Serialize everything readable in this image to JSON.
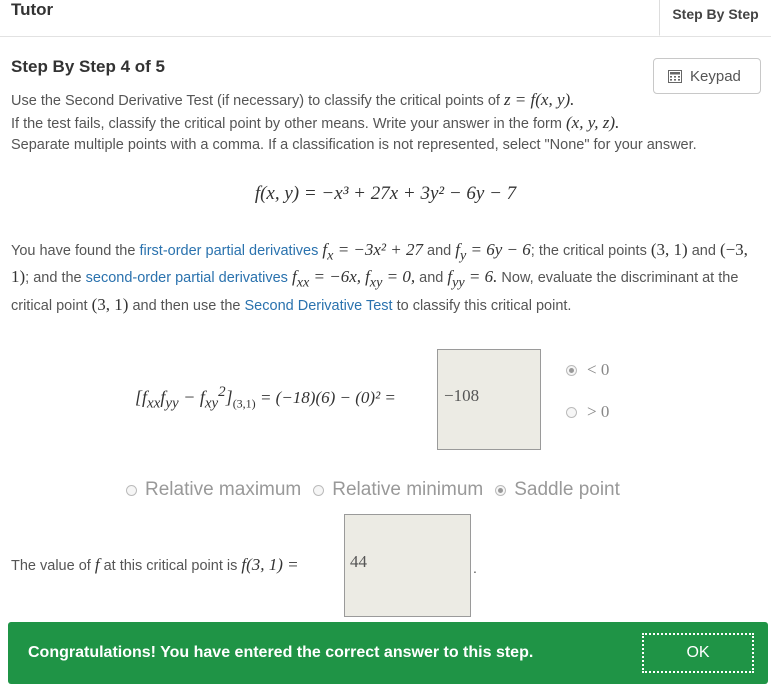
{
  "header": {
    "title": "Tutor",
    "tab": "Step By Step"
  },
  "step": {
    "heading": "Step By Step 4 of 5",
    "keypad_label": "Keypad"
  },
  "intro": {
    "line1_text": "Use the Second Derivative Test (if necessary) to classify the critical points of ",
    "line1_math": "z = f(x, y).",
    "line2_text": "If the test fails, classify the critical point by other means. Write your answer in the form ",
    "line2_math": "(x, y, z).",
    "line3": "Separate multiple points with a comma. If a classification is not represented, select \"None\" for your answer."
  },
  "function_formula": "f(x, y) = −x³ + 27x + 3y² − 6y − 7",
  "found": {
    "t1": "You have found the ",
    "link1": "first-order partial derivatives",
    "fx": "f",
    "fx_sub": "x",
    "fx_rhs": " = −3x² + 27",
    "t2": " and ",
    "fy": "f",
    "fy_sub": "y",
    "fy_rhs": " = 6y − 6",
    "t3": "; the critical points ",
    "cp1": "(3, 1)",
    "t4": " and ",
    "cp2": "(−3, 1)",
    "t5": "; and the ",
    "link2": "second-order partial derivatives",
    "fxx_sub": "xx",
    "fxx_rhs": " = −6x,",
    "fxy_sub": "xy",
    "fxy_rhs": " = 0,",
    "t6": " and ",
    "fyy_sub": "yy",
    "fyy_rhs": " = 6.",
    "t7": " Now, evaluate the discriminant at the critical point ",
    "cp3": "(3, 1)",
    "t8": " and then use the ",
    "link3": "Second Derivative Test",
    "t9": " to classify this critical point."
  },
  "discriminant": {
    "expression_left": "[f",
    "sub_xx": "xx",
    "f_yy": "f",
    "sub_yy": "yy",
    "minus": " − f",
    "sub_xy": "xy",
    "sup_2": "2",
    "bracket_close": "]",
    "sub_point": "(3,1)",
    "expression_right": " = (−18)(6) − (0)² =",
    "answer": "−108"
  },
  "sign_options": [
    {
      "label": "< 0",
      "selected": true
    },
    {
      "label": "> 0",
      "selected": false
    }
  ],
  "classification_options": [
    {
      "label": "Relative maximum",
      "selected": false
    },
    {
      "label": "Relative minimum",
      "selected": false
    },
    {
      "label": "Saddle point",
      "selected": true
    }
  ],
  "value": {
    "text": "The value of ",
    "f": "f",
    "text2": " at this critical point is ",
    "expr": "f(3, 1) =",
    "answer": "44",
    "period": "."
  },
  "banner": {
    "message": "Congratulations! You have entered the correct answer to this step.",
    "ok_label": "OK",
    "color": "#1f9446"
  }
}
